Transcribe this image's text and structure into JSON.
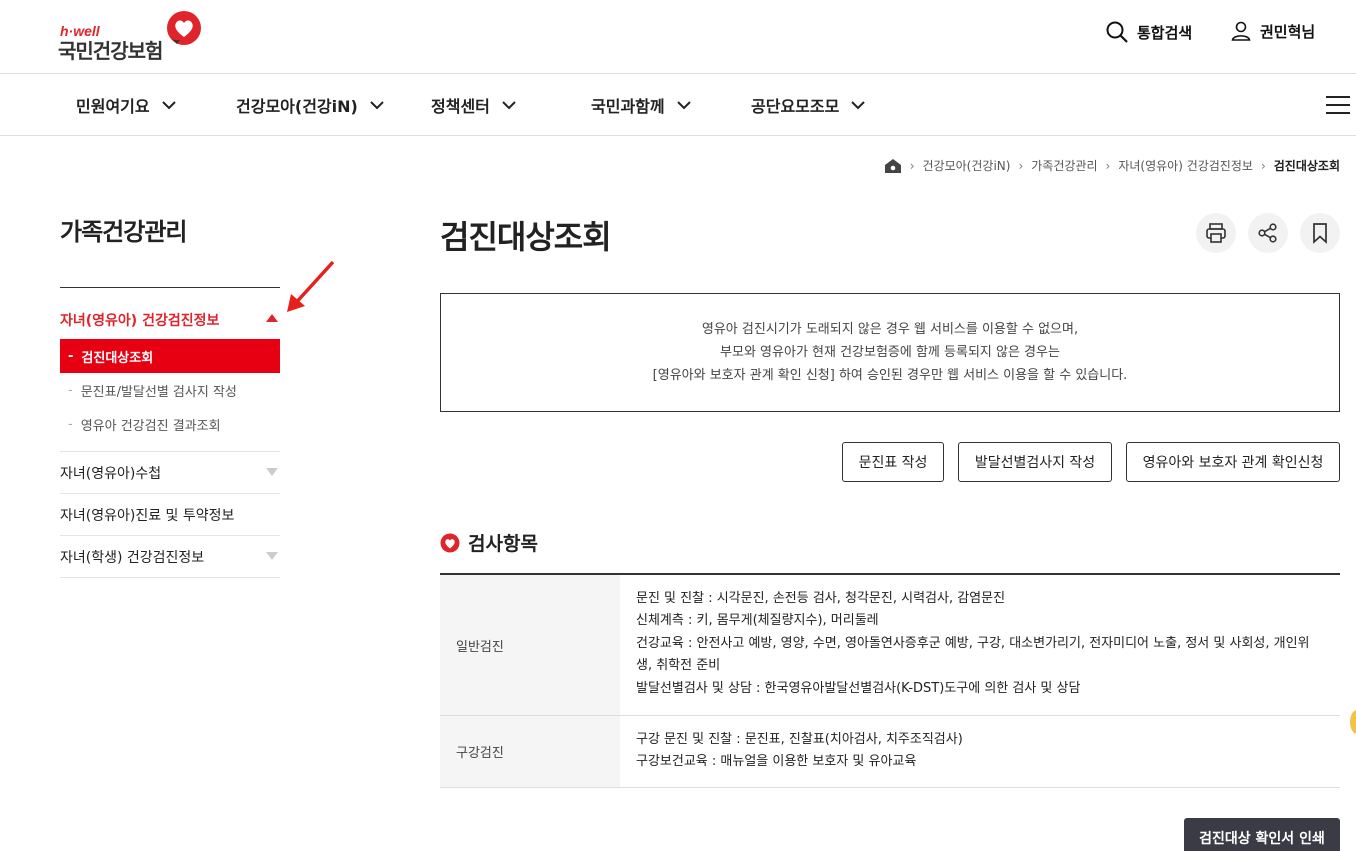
{
  "header": {
    "logo_sub": "h·well",
    "logo_name": "국민건강보험",
    "search_label": "통합검색",
    "user_label": "권민혁님"
  },
  "gnb": {
    "items": [
      {
        "label": "민원여기요"
      },
      {
        "label": "건강모아(건강iN)"
      },
      {
        "label": "정책센터"
      },
      {
        "label": "국민과함께"
      },
      {
        "label": "공단요모조모"
      }
    ]
  },
  "breadcrumb": {
    "items": [
      "건강모아(건강iN)",
      "가족건강관리",
      "자녀(영유아) 건강검진정보",
      "검진대상조회"
    ]
  },
  "lnb": {
    "title": "가족건강관리",
    "active_group": "자녀(영유아) 건강검진정보",
    "active_sub": "검진대상조회",
    "subs": [
      "문진표/발달선별 검사지 작성",
      "영유아 건강검진 결과조회"
    ],
    "groups": [
      "자녀(영유아)수첩",
      "자녀(영유아)진료 및 투약정보",
      "자녀(학생) 건강검진정보"
    ]
  },
  "main": {
    "title": "검진대상조회",
    "notice": [
      "영유아 검진시기가 도래되지 않은 경우 웹 서비스를 이용할 수 없으며,",
      "부모와 영유아가 현재 건강보험증에 함께 등록되지 않은 경우는",
      "[영유아와 보호자 관계 확인 신청] 하여 승인된 경우만 웹 서비스 이용을 할 수 있습니다."
    ],
    "buttons": [
      "문진표 작성",
      "발달선별검사지 작성",
      "영유아와 보호자 관계 확인신청"
    ],
    "section_title": "검사항목",
    "table": [
      {
        "head": "일반검진",
        "lines": [
          "문진 및 진찰 : 시각문진, 손전등 검사, 청각문진, 시력검사, 감염문진",
          "신체계측 : 키, 몸무게(체질량지수), 머리둘레",
          "건강교육 : 안전사고 예방, 영양, 수면, 영아돌연사증후군 예방, 구강, 대소변가리기, 전자미디어 노출, 정서 및 사회성, 개인위생, 취학전 준비",
          "발달선별검사 및 상담 : 한국영유아발달선별검사(K-DST)도구에 의한 검사 및 상담"
        ]
      },
      {
        "head": "구강검진",
        "lines": [
          "구강 문진 및 진찰 : 문진표, 진찰표(치아검사, 치주조직검사)",
          "구강보건교육 : 매뉴얼을 이용한 보호자 및 유아교육"
        ]
      }
    ],
    "print_button": "검진대상 확인서 인쇄"
  },
  "colors": {
    "brand_red": "#e0242c",
    "active_bg": "#e60012",
    "print_btn_bg": "#3b3b46"
  }
}
